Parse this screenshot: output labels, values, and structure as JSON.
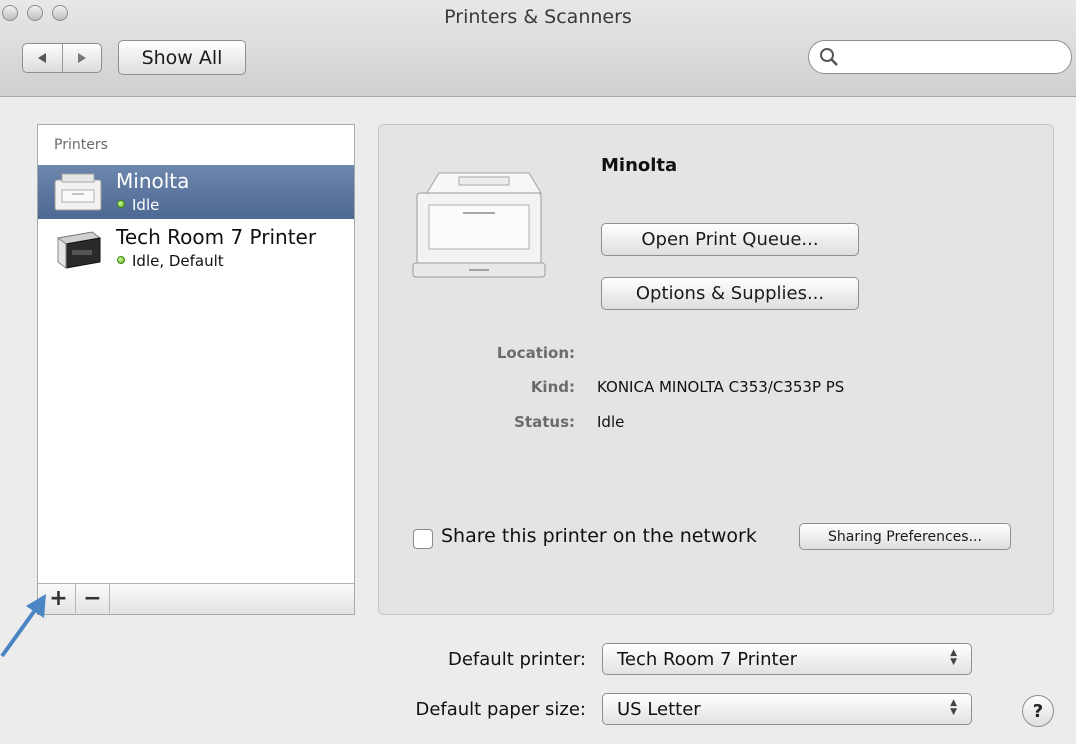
{
  "window": {
    "title": "Printers & Scanners"
  },
  "toolbar": {
    "show_all": "Show All",
    "search_placeholder": ""
  },
  "sidebar": {
    "heading": "Printers",
    "items": [
      {
        "name": "Minolta",
        "status": "Idle",
        "selected": true
      },
      {
        "name": "Tech Room 7 Printer",
        "status": "Idle, Default",
        "selected": false
      }
    ],
    "add_label": "+",
    "remove_label": "−"
  },
  "detail": {
    "printer_name": "Minolta",
    "open_queue": "Open Print Queue...",
    "options_supplies": "Options & Supplies...",
    "location_label": "Location:",
    "location_value": "",
    "kind_label": "Kind:",
    "kind_value": "KONICA MINOLTA C353/C353P PS",
    "status_label": "Status:",
    "status_value": "Idle",
    "share_label": "Share this printer on the network",
    "share_checked": false,
    "sharing_prefs": "Sharing Preferences..."
  },
  "footer": {
    "default_printer_label": "Default printer:",
    "default_printer_value": "Tech Room 7 Printer",
    "paper_size_label": "Default paper size:",
    "paper_size_value": "US Letter",
    "help": "?"
  },
  "colors": {
    "selection": "#5a7399",
    "status_dot": "#4fa61d",
    "annotation_arrow": "#4a86c4"
  }
}
